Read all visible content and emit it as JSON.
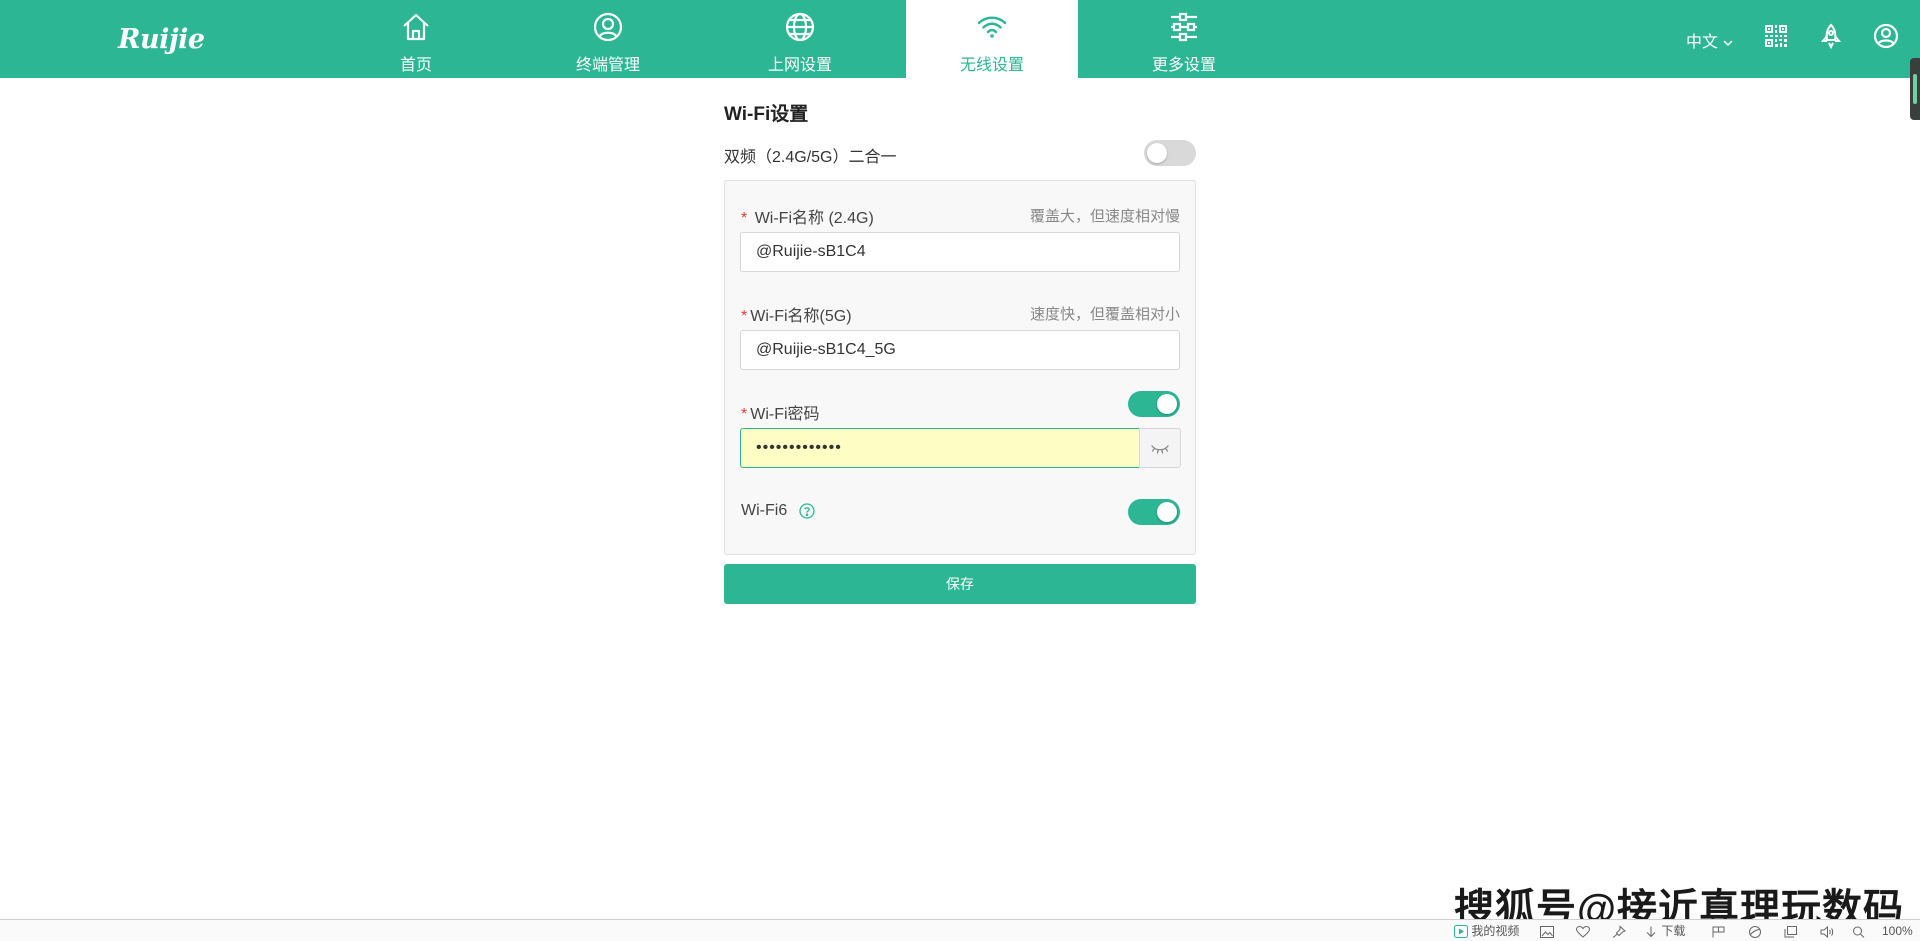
{
  "header": {
    "logo_text": "Ruijie",
    "nav": [
      {
        "label": "首页",
        "icon": "home-icon"
      },
      {
        "label": "终端管理",
        "icon": "user-circle-icon"
      },
      {
        "label": "上网设置",
        "icon": "globe-icon"
      },
      {
        "label": "无线设置",
        "icon": "wifi-icon",
        "active": true
      },
      {
        "label": "更多设置",
        "icon": "sliders-icon"
      }
    ],
    "language": "中文",
    "right_icons": [
      "qr-code-icon",
      "rocket-icon",
      "account-icon"
    ],
    "accent_color": "#2db694"
  },
  "wifi": {
    "title": "Wi-Fi设置",
    "dual_band_label": "双频（2.4G/5G）二合一",
    "dual_band_enabled": false,
    "ssid_24": {
      "required_mark": "*",
      "label": "Wi-Fi名称 (2.4G)",
      "hint": "覆盖大，但速度相对慢",
      "value": "@Ruijie-sB1C4"
    },
    "ssid_5": {
      "required_mark": "*",
      "label": "Wi-Fi名称(5G)",
      "hint": "速度快，但覆盖相对小",
      "value": "@Ruijie-sB1C4_5G"
    },
    "password": {
      "required_mark": "*",
      "label": "Wi-Fi密码",
      "enabled": true,
      "masked_value": "•••••••••••••"
    },
    "wifi6": {
      "label": "Wi-Fi6",
      "enabled": true
    },
    "save_label": "保存"
  },
  "watermark": "搜狐号@接近真理玩数码",
  "statusbar": {
    "my_video": "我的视频",
    "download": "下载",
    "zoom": "100%"
  }
}
